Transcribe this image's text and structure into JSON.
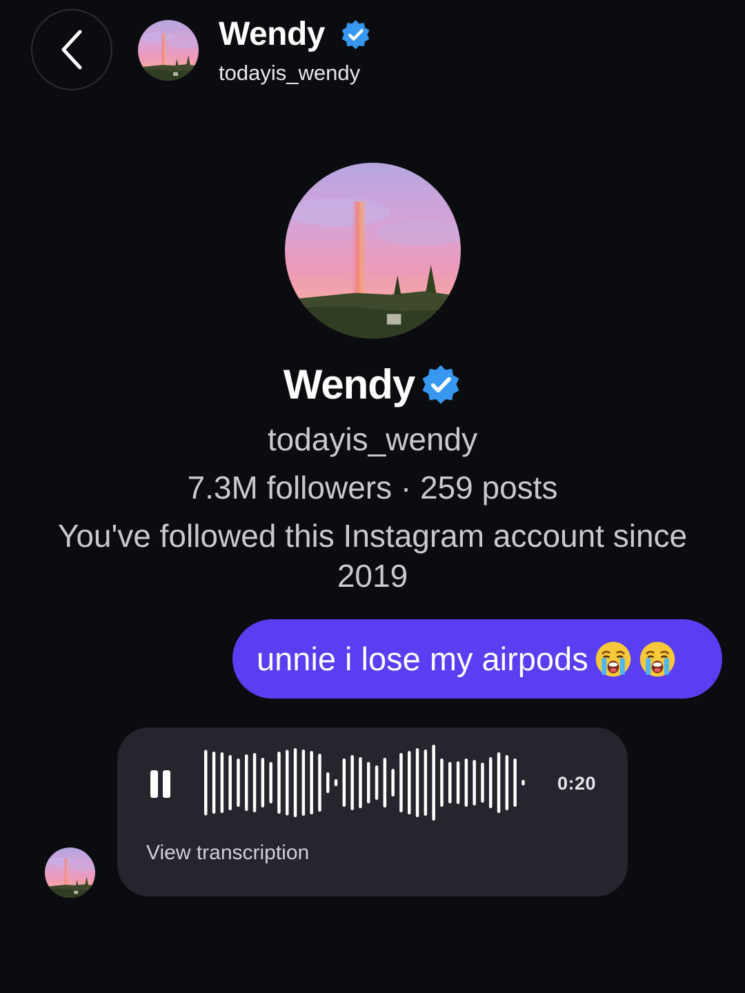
{
  "header": {
    "name": "Wendy",
    "username": "todayis_wendy",
    "back_icon": "chevron-left-icon",
    "verified_icon": "verified-badge-icon"
  },
  "profile": {
    "name": "Wendy",
    "username": "todayis_wendy",
    "stats": "7.3M followers · 259 posts",
    "followed_since": "You've followed this Instagram account since 2019"
  },
  "messages": [
    {
      "direction": "outgoing",
      "text": "unnie i lose my airpods",
      "emojis": [
        "loudly-crying-face-icon",
        "loudly-crying-face-icon"
      ]
    },
    {
      "direction": "incoming",
      "type": "voice",
      "duration": "0:20",
      "transcription_label": "View transcription",
      "control_icon": "pause-icon"
    }
  ],
  "colors": {
    "background": "#0b0c10",
    "outgoing_bubble": "#5a3ff2",
    "incoming_bubble": "#24252d",
    "verified": "#3897f0"
  }
}
